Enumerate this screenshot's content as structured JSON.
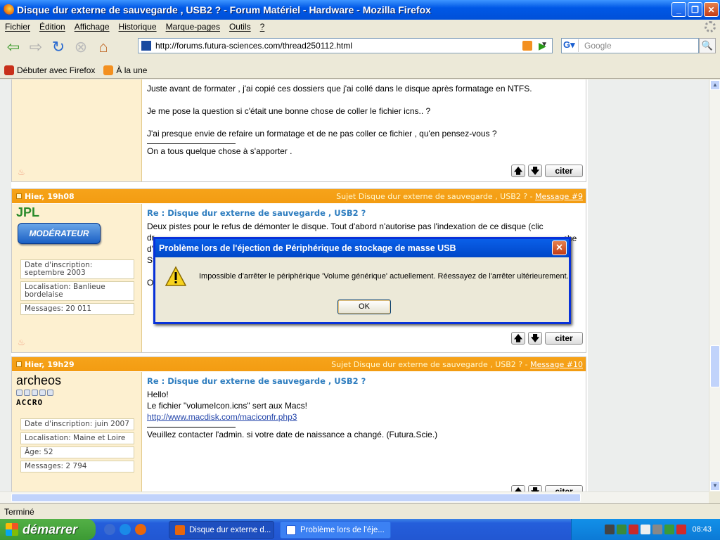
{
  "window": {
    "title": "Disque dur externe de sauvegarde , USB2 ? - Forum Matériel - Hardware - Mozilla Firefox"
  },
  "menu": [
    "Fichier",
    "Édition",
    "Affichage",
    "Historique",
    "Marque-pages",
    "Outils",
    "?"
  ],
  "address": {
    "url": "http://forums.futura-sciences.com/thread250112.html"
  },
  "search": {
    "placeholder": "Google"
  },
  "bookmarks": [
    "Débuter avec Firefox",
    "À la une"
  ],
  "posts": [
    {
      "lines": [
        "Juste avant de formater , j'ai copié ces dossiers que j'ai collé dans le disque après formatage en NTFS.",
        "Je me pose la question si c'était une bonne chose de coller le fichier icns.. ?",
        "J'ai presque envie de refaire un formatage et de ne pas coller ce fichier , qu'en pensez-vous ?",
        "On a tous quelque chose à s'apporter ."
      ],
      "citer": "citer"
    },
    {
      "date": "Hier, 19h08",
      "subject": "Sujet Disque dur externe de sauvegarde , USB2 ? - ",
      "msg": "Message #9",
      "author": "JPL",
      "badge": "MODÉRATEUR",
      "info": [
        "Date d'inscription: septembre 2003",
        "Localisation: Banlieue bordelaise",
        "Messages: 20 011"
      ],
      "title": "Re : Disque dur externe de sauvegarde , USB2 ?",
      "lines": [
        "Deux pistes pour le refus de démonter le disque. Tout d'abord n'autorise pas l'indexation de ce disque (clic",
        "dr",
        "d'e",
        "St",
        "On"
      ],
      "right_fragment": "che",
      "citer": "citer"
    },
    {
      "date": "Hier, 19h29",
      "subject": "Sujet Disque dur externe de sauvegarde , USB2 ? - ",
      "msg": "Message #10",
      "author": "archeos",
      "rank": "ACCRO",
      "info": [
        "Date d'inscription: juin 2007",
        "Localisation: Maine et Loire",
        "Âge: 52",
        "Messages: 2 794"
      ],
      "title": "Re : Disque dur externe de sauvegarde , USB2 ?",
      "lines": [
        "Hello!",
        "Le fichier \"volumeIcon.icns\" sert aux Macs!"
      ],
      "link": "http://www.macdisk.com/maciconfr.php3",
      "signature": "Veuillez contacter l'admin. si votre date de naissance a changé. (Futura.Scie.)",
      "citer": "citer"
    }
  ],
  "dialog": {
    "title": "Problème lors de l'éjection de Périphérique de stockage de masse USB",
    "message": "Impossible d'arrêter le périphérique 'Volume générique' actuellement. Réessayez de l'arrêter ultérieurement.",
    "ok": "OK"
  },
  "status": "Terminé",
  "taskbar": {
    "start": "démarrer",
    "tasks": [
      "Disque dur externe d...",
      "Problème lors de l'éje..."
    ],
    "clock": "08:43"
  }
}
